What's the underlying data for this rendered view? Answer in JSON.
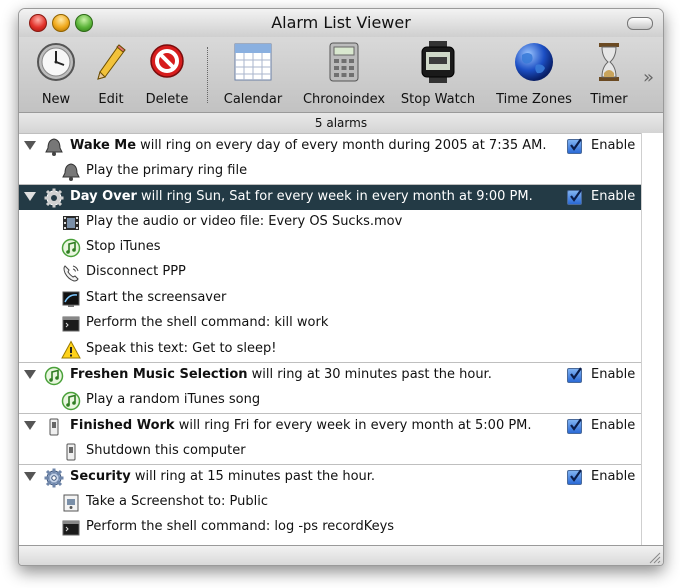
{
  "window": {
    "title": "Alarm List Viewer"
  },
  "toolbar": {
    "items": [
      {
        "label": "New",
        "icon": "clock-icon"
      },
      {
        "label": "Edit",
        "icon": "pencil-icon"
      },
      {
        "label": "Delete",
        "icon": "delete-icon"
      },
      {
        "label": "Calendar",
        "icon": "calendar-icon"
      },
      {
        "label": "Chronoindex",
        "icon": "calculator-icon"
      },
      {
        "label": "Stop Watch",
        "icon": "stopwatch-icon"
      },
      {
        "label": "Time Zones",
        "icon": "globe-icon"
      },
      {
        "label": "Timer",
        "icon": "hourglass-icon"
      }
    ],
    "overflow": "»"
  },
  "status": {
    "count": "5 alarms"
  },
  "enable_label": "Enable",
  "rows": [
    {
      "type": "alarm",
      "name": "Wake Me",
      "desc": " will ring on every day of every month during 2005 at 7:35 AM.",
      "enabled": true,
      "icon": "bell-icon"
    },
    {
      "type": "step",
      "text": "Play the primary ring file",
      "icon": "bell-icon"
    },
    {
      "type": "alarm",
      "name": "Day Over",
      "desc": " will ring Sun, Sat for every week in every month at 9:00 PM.",
      "enabled": true,
      "selected": true,
      "icon": "gear-icon"
    },
    {
      "type": "step",
      "text": "Play the audio or video file: Every OS Sucks.mov",
      "icon": "film-icon"
    },
    {
      "type": "step",
      "text": "Stop iTunes",
      "icon": "itunes-icon"
    },
    {
      "type": "step",
      "text": "Disconnect PPP",
      "icon": "phone-icon"
    },
    {
      "type": "step",
      "text": "Start the screensaver",
      "icon": "screensaver-icon"
    },
    {
      "type": "step",
      "text": "Perform the shell command: kill work",
      "icon": "terminal-icon"
    },
    {
      "type": "step",
      "text": "Speak this text: Get to sleep!",
      "icon": "warning-icon"
    },
    {
      "type": "alarm",
      "name": "Freshen Music Selection",
      "desc": " will ring at 30 minutes past the hour.",
      "enabled": true,
      "icon": "itunes-icon"
    },
    {
      "type": "step",
      "text": "Play a random iTunes song",
      "icon": "itunes-icon"
    },
    {
      "type": "alarm",
      "name": "Finished Work",
      "desc": " will ring Fri for every week in every month at 5:00 PM.",
      "enabled": true,
      "icon": "power-switch-icon"
    },
    {
      "type": "step",
      "text": "Shutdown this computer",
      "icon": "power-switch-icon"
    },
    {
      "type": "alarm",
      "name": "Security",
      "desc": " will ring at 15 minutes past the hour.",
      "enabled": true,
      "icon": "gear-icon"
    },
    {
      "type": "step",
      "text": "Take a Screenshot to: Public",
      "icon": "screenshot-icon"
    },
    {
      "type": "step",
      "text": "Perform the shell command: log -ps recordKeys",
      "icon": "terminal-icon"
    }
  ],
  "colors": {
    "selection": "#233a45",
    "checkbox": "#2a6ad6"
  }
}
